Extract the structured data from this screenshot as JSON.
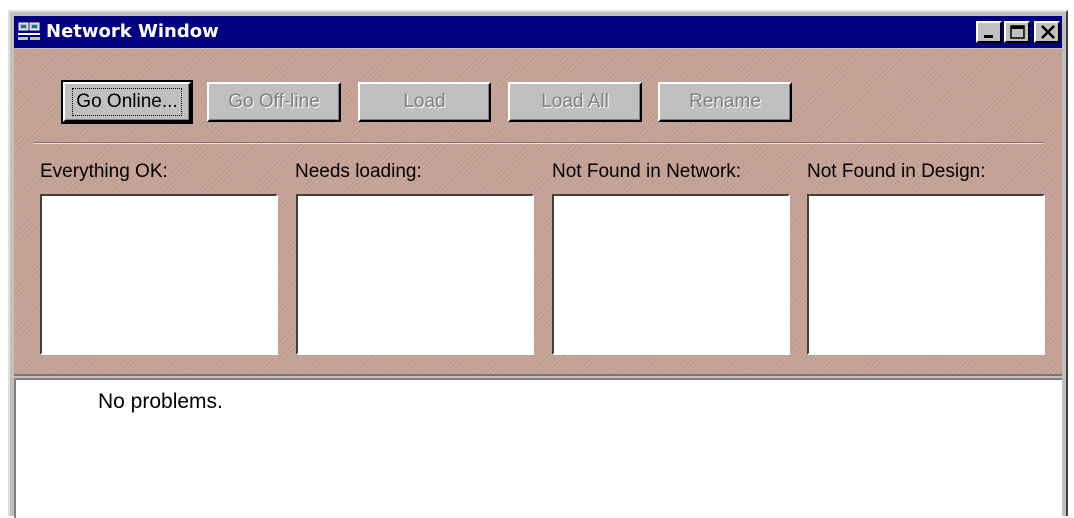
{
  "window": {
    "title": "Network Window",
    "icon": "network-computer-icon",
    "controls": {
      "minimize": "minimize-icon",
      "maximize": "maximize-icon",
      "close": "close-icon"
    }
  },
  "toolbar": {
    "go_online": "Go Online...",
    "go_offline": "Go Off-line",
    "load": "Load",
    "load_all": "Load All",
    "rename": "Rename"
  },
  "lists": {
    "everything_ok": "Everything OK:",
    "needs_loading": "Needs loading:",
    "not_found_network": "Not Found in Network:",
    "not_found_design": "Not Found in Design:"
  },
  "output": {
    "message": "No problems."
  },
  "colors": {
    "titlebar": "#000080",
    "panel": "#c5a296",
    "face": "#c0c0c0"
  }
}
